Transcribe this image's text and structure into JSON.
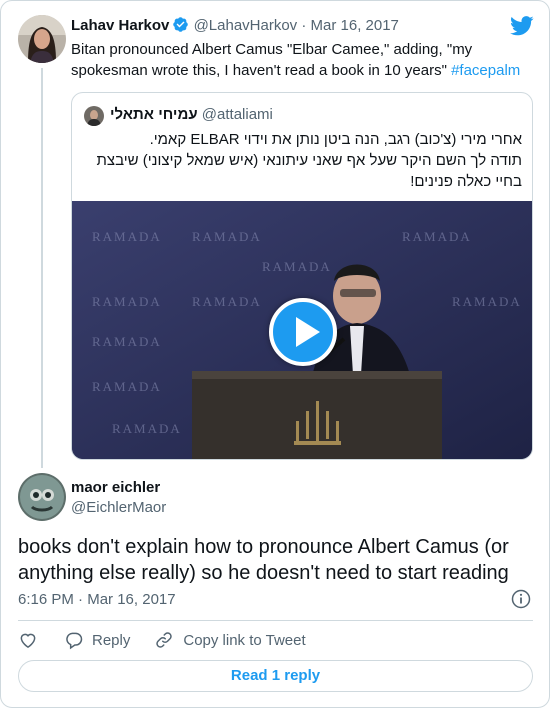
{
  "colors": {
    "accent": "#1d9bf0",
    "text": "#0f1419",
    "muted": "#536471",
    "border": "#cfd9de"
  },
  "parent": {
    "name": "Lahav Harkov",
    "handle": "@LahavHarkov",
    "separator": "·",
    "date": "Mar 16, 2017",
    "verified_icon": "verified-badge-icon",
    "text": "Bitan pronounced Albert Camus \"Elbar Camee,\" adding, \"my spokesman wrote this, I haven't read a book in 10 years\"",
    "hashtag": "#facepalm"
  },
  "quote": {
    "name": "עמיחי אתאלי",
    "handle": "@attaliami",
    "text_line1": "אחרי מירי (צ'כוב) רגב, הנה ביטן נותן את וידוי ELBAR קאמי.",
    "text_line2": "תודה לך השם היקר שעל אף שאני עיתונאי (איש שמאל קיצוני) שיבצת בחיי כאלה פנינים!",
    "video_wall_text": "RAMADA",
    "play_icon": "play-icon"
  },
  "reply": {
    "name": "maor eichler",
    "handle": "@EichlerMaor",
    "text": "books don't explain how to pronounce Albert Camus (or anything else really) so he doesn't need to start reading",
    "time": "6:16 PM",
    "separator": "·",
    "date": "Mar 16, 2017"
  },
  "actions": {
    "like_icon": "heart-icon",
    "reply_label": "Reply",
    "copy_label": "Copy link to Tweet"
  },
  "read_replies_label": "Read 1 reply",
  "brand_icon": "twitter-bird-icon"
}
